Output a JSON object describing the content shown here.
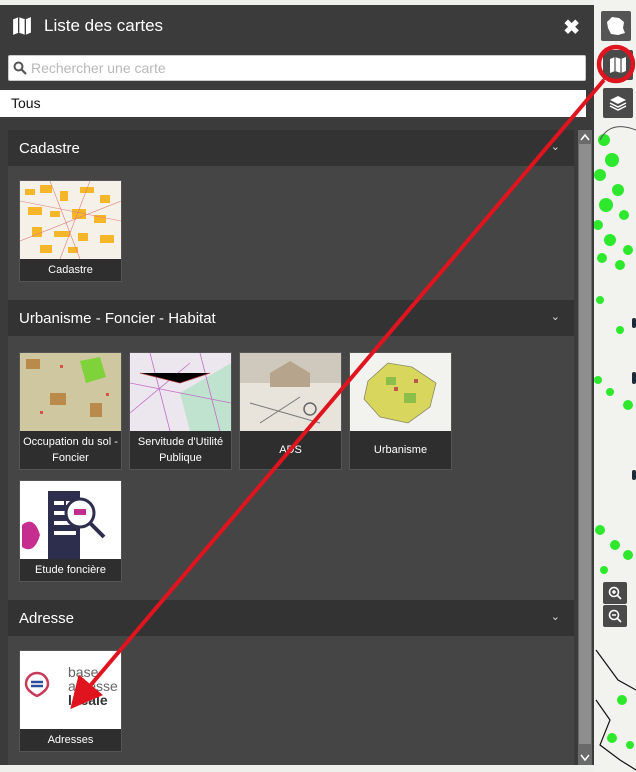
{
  "panel": {
    "title": "Liste des cartes",
    "close_label": "✖",
    "search_placeholder": "Rechercher une carte",
    "filter_value": "Tous"
  },
  "sections": [
    {
      "title": "Cadastre",
      "cards": [
        {
          "label": "Cadastre"
        }
      ]
    },
    {
      "title": "Urbanisme - Foncier - Habitat",
      "cards": [
        {
          "label": "Occupation du sol - Foncier"
        },
        {
          "label": "Servitude d'Utilité Publique"
        },
        {
          "label": "ADS"
        },
        {
          "label": "Urbanisme"
        },
        {
          "label": "Etude foncière"
        }
      ]
    },
    {
      "title": "Adresse",
      "cards": [
        {
          "label": "Adresses"
        }
      ]
    }
  ],
  "bal_logo_text": [
    "base",
    "adresse",
    "locale"
  ],
  "map_controls": [
    "france-map-icon",
    "map-list-icon",
    "layers-icon",
    "zoom-in-icon",
    "zoom-out-icon"
  ],
  "colors": {
    "panel_bg": "#3b3b3b",
    "section_header": "#333333",
    "list_bg": "#454545",
    "annotation_red": "#e0141e",
    "map_green": "#2ee82e"
  }
}
